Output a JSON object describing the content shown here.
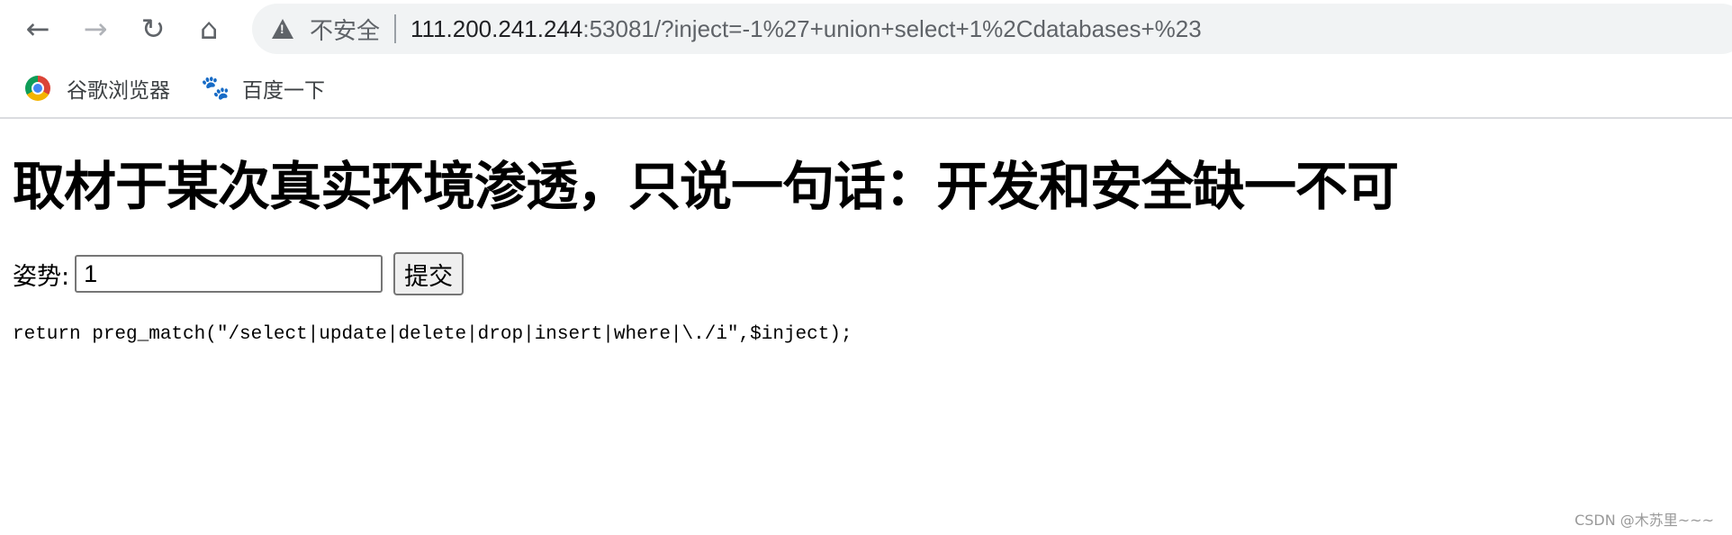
{
  "browser": {
    "nav": {
      "back_icon": "arrow-left",
      "forward_icon": "arrow-right",
      "reload_icon": "reload",
      "home_icon": "home"
    },
    "address_bar": {
      "security_label": "不安全",
      "url_host": "111.200.241.244",
      "url_rest": ":53081/?inject=-1%27+union+select+1%2Cdatabases+%23"
    },
    "bookmarks": [
      {
        "label": "谷歌浏览器",
        "icon": "chrome-logo"
      },
      {
        "label": "百度一下",
        "icon": "baidu-paw"
      }
    ]
  },
  "page": {
    "title": "取材于某次真实环境渗透，只说一句话：开发和安全缺一不可",
    "form": {
      "label": "姿势:",
      "input_value": "1",
      "submit_label": "提交"
    },
    "code": "return preg_match(\"/select|update|delete|drop|insert|where|\\./i\",$inject);"
  },
  "watermark": "CSDN @木苏里~~~"
}
